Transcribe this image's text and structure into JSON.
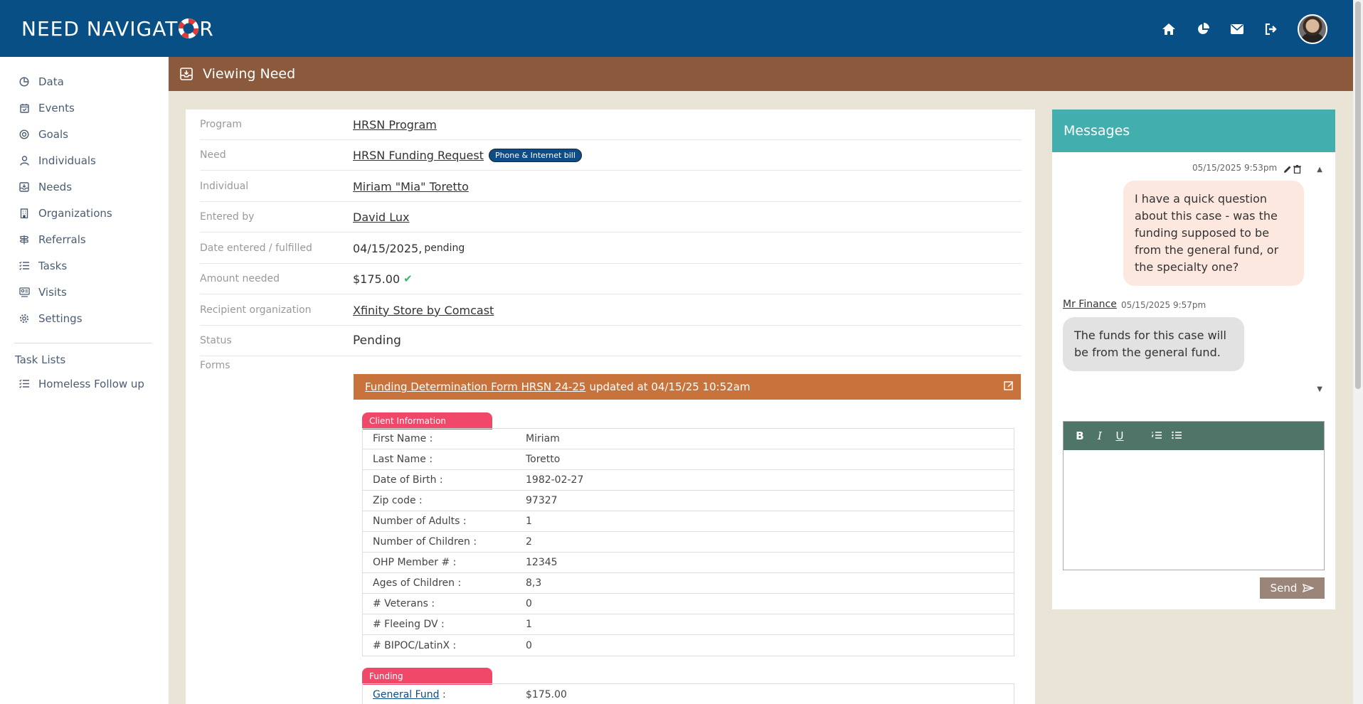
{
  "app": {
    "logo_before": "NEED NAVIGAT",
    "logo_after": "R"
  },
  "topbar_icons": [
    "home-icon",
    "pie-chart-icon",
    "mail-icon",
    "logout-icon"
  ],
  "sidebar": {
    "items": [
      {
        "label": "Data",
        "icon": "chart-icon"
      },
      {
        "label": "Events",
        "icon": "calendar-icon"
      },
      {
        "label": "Goals",
        "icon": "target-icon"
      },
      {
        "label": "Individuals",
        "icon": "user-icon"
      },
      {
        "label": "Needs",
        "icon": "inbox-icon"
      },
      {
        "label": "Organizations",
        "icon": "building-icon"
      },
      {
        "label": "Referrals",
        "icon": "signpost-icon"
      },
      {
        "label": "Tasks",
        "icon": "list-icon"
      },
      {
        "label": "Visits",
        "icon": "visit-icon"
      },
      {
        "label": "Settings",
        "icon": "gear-icon"
      }
    ],
    "task_lists_title": "Task Lists",
    "task_lists": [
      {
        "label": "Homeless Follow up",
        "icon": "list-icon"
      }
    ]
  },
  "page": {
    "title": "Viewing Need"
  },
  "details": {
    "program_label": "Program",
    "program_value": "HRSN Program",
    "need_label": "Need",
    "need_value": "HRSN Funding Request",
    "need_badge": "Phone & Internet bill",
    "individual_label": "Individual",
    "individual_value": "Miriam \"Mia\" Toretto",
    "entered_by_label": "Entered by",
    "entered_by_value": "David Lux",
    "date_label": "Date entered / fulfilled",
    "date_value": "04/15/2025,",
    "date_status": "pending",
    "amount_label": "Amount needed",
    "amount_value": "$175.00",
    "recipient_label": "Recipient organization",
    "recipient_value": "Xfinity Store by Comcast",
    "status_label": "Status",
    "status_value": "Pending",
    "forms_label": "Forms"
  },
  "form": {
    "link": "Funding Determination Form HRSN 24-25",
    "updated": "updated at 04/15/25 10:52am",
    "sections": [
      {
        "title": "Client Information",
        "rows": [
          {
            "k": "First Name :",
            "v": "Miriam"
          },
          {
            "k": "Last Name :",
            "v": "Toretto"
          },
          {
            "k": "Date of Birth :",
            "v": "1982-02-27"
          },
          {
            "k": "Zip code :",
            "v": "97327"
          },
          {
            "k": "Number of Adults :",
            "v": "1"
          },
          {
            "k": "Number of Children :",
            "v": "2"
          },
          {
            "k": "OHP Member # :",
            "v": "12345"
          },
          {
            "k": "Ages of Children :",
            "v": "8,3"
          },
          {
            "k": "# Veterans :",
            "v": "0"
          },
          {
            "k": "# Fleeing DV :",
            "v": "1"
          },
          {
            "k": "# BIPOC/LatinX :",
            "v": "0"
          }
        ]
      },
      {
        "title": "Funding",
        "rows": [
          {
            "k": "General Fund",
            "k_suffix": " :",
            "v": "$175.00",
            "link": true
          }
        ]
      }
    ]
  },
  "messages": {
    "title": "Messages",
    "msg1_time": "05/15/2025 9:53pm",
    "msg1_text": "I have a quick question about this case - was the funding supposed to be from the general fund, or the specialty one?",
    "msg2_sender": "Mr Finance",
    "msg2_time": "05/15/2025 9:57pm",
    "msg2_text": "The funds for this case will be from the general fund.",
    "send_label": "Send"
  }
}
